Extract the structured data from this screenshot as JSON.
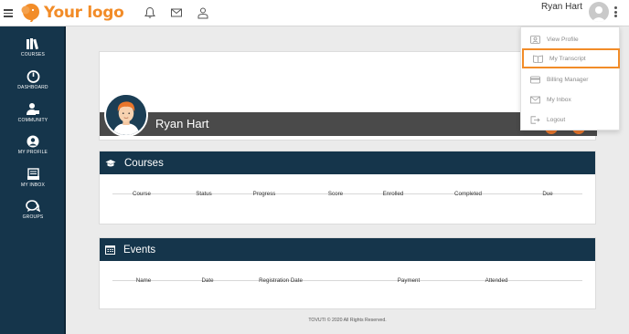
{
  "topbar": {
    "logo_text": "Your logo",
    "user_name": "Ryan Hart",
    "icons": [
      "menu-icon",
      "bell-icon",
      "mail-icon",
      "user-icon",
      "kebab-icon"
    ]
  },
  "sidebar": {
    "items": [
      {
        "label": "COURSES",
        "icon": "books-icon"
      },
      {
        "label": "DASHBOARD",
        "icon": "gauge-icon"
      },
      {
        "label": "COMMUNITY",
        "icon": "community-icon"
      },
      {
        "label": "MY PROFILE",
        "icon": "profile-icon"
      },
      {
        "label": "MY INBOX",
        "icon": "inbox-icon"
      },
      {
        "label": "GROUPS",
        "icon": "chat-icon"
      }
    ]
  },
  "profile": {
    "name": "Ryan Hart"
  },
  "courses": {
    "title": "Courses",
    "columns": [
      "Course",
      "Status",
      "Progress",
      "Score",
      "Enrolled",
      "Completed",
      "Due"
    ]
  },
  "events": {
    "title": "Events",
    "columns": [
      "Name",
      "Date",
      "Registration Date",
      "Payment",
      "Attended"
    ]
  },
  "footer": {
    "text": "TOVUTI © 2020 All Rights Reserved."
  },
  "dropdown": {
    "items": [
      {
        "label": "View Profile",
        "icon": "profile-card-icon"
      },
      {
        "label": "My Transcript",
        "icon": "book-open-icon"
      },
      {
        "label": "Billing Manager",
        "icon": "credit-card-icon"
      },
      {
        "label": "My Inbox",
        "icon": "envelope-icon"
      },
      {
        "label": "Logout",
        "icon": "logout-icon"
      }
    ],
    "highlight_color": "#f28c28"
  },
  "colors": {
    "brand_orange": "#f28c28",
    "navy": "#15354b",
    "accent_orange": "#e8762c"
  }
}
